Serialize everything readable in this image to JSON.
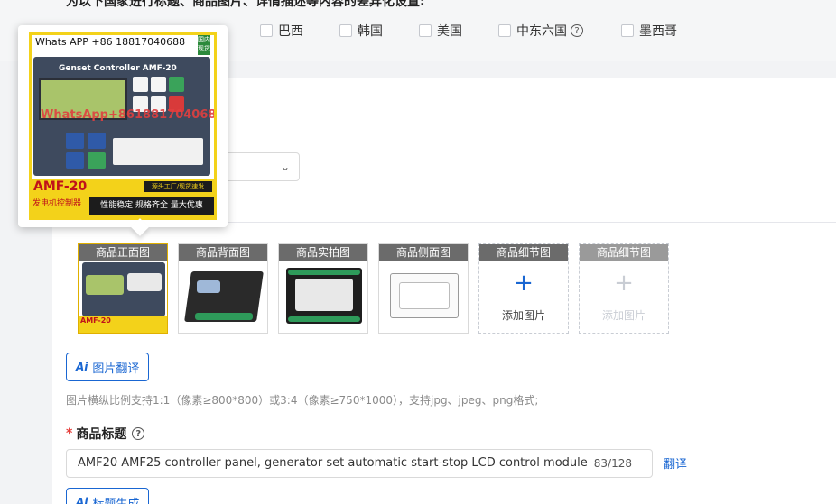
{
  "top_heading": "为以下国家进行标题、商品图片、详情描述等内容的差异化设置:",
  "countries": [
    {
      "label": "巴西"
    },
    {
      "label": "韩国"
    },
    {
      "label": "美国"
    },
    {
      "label": "中东六国"
    },
    {
      "label": "墨西哥"
    }
  ],
  "popover": {
    "whatsapp": "Whats APP +86 18817040688",
    "badge": "国内现货",
    "device_title": "Genset Controller AMF-20",
    "watermark": "WhatsApp+8618817040688",
    "model": "AMF-20",
    "model_sub": "发电机控制器",
    "source_tag": "源头工厂/现货速发",
    "slogan": "性能稳定 规格齐全 量大优惠"
  },
  "images": [
    {
      "label": "商品正面图",
      "state": "filled"
    },
    {
      "label": "商品背面图",
      "state": "filled"
    },
    {
      "label": "商品实拍图",
      "state": "filled"
    },
    {
      "label": "商品侧面图",
      "state": "filled"
    },
    {
      "label": "商品细节图",
      "state": "add",
      "add_text": "添加图片"
    },
    {
      "label": "商品细节图",
      "state": "add-disabled",
      "add_text": "添加图片"
    }
  ],
  "thumb_model": "AMF-20",
  "image_translate_btn": "图片翻译",
  "ai_badge": "Ai",
  "image_hint": "图片横纵比例支持1:1（像素≥800*800）或3:4（像素≥750*1000），支持jpg、jpeg、png格式;",
  "title_field": {
    "label": "商品标题",
    "value": "AMF20 AMF25 controller panel, generator set automatic start-stop LCD control module",
    "counter": "83/128",
    "translate": "翻译"
  },
  "title_gen_btn": "标题生成",
  "colors": {
    "accent": "#1966d2",
    "required": "#e53935",
    "highlight": "#f3d21a"
  }
}
